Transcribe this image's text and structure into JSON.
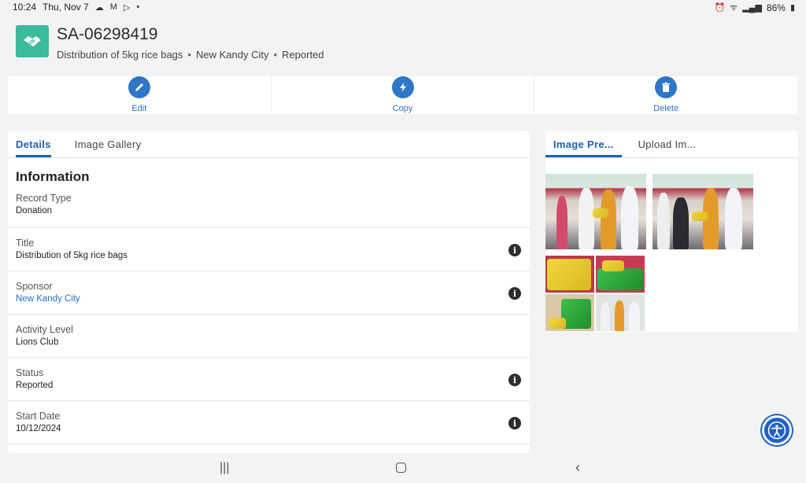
{
  "status_bar": {
    "time": "10:24",
    "date": "Thu, Nov 7",
    "battery": "86%"
  },
  "record": {
    "number": "SA-06298419",
    "subtitle_title": "Distribution of 5kg rice bags",
    "subtitle_sponsor": "New Kandy City",
    "subtitle_status": "Reported",
    "icon": "handshake-icon",
    "icon_color": "#3bba9c"
  },
  "actions": [
    {
      "label": "Edit",
      "icon": "pencil-icon"
    },
    {
      "label": "Copy",
      "icon": "lightning-icon"
    },
    {
      "label": "Delete",
      "icon": "trash-icon"
    }
  ],
  "left_tabs": {
    "details": "Details",
    "gallery": "Image Gallery"
  },
  "section_title": "Information",
  "fields": {
    "record_type": {
      "label": "Record Type",
      "value": "Donation"
    },
    "title": {
      "label": "Title",
      "value": "Distribution of 5kg rice bags"
    },
    "sponsor": {
      "label": "Sponsor",
      "value": "New Kandy City"
    },
    "activity_level": {
      "label": "Activity Level",
      "value": "Lions Club"
    },
    "status": {
      "label": "Status",
      "value": "Reported"
    },
    "start_date": {
      "label": "Start Date",
      "value": "10/12/2024"
    }
  },
  "right_tabs": {
    "preview": "Image Pre...",
    "upload": "Upload Im..."
  },
  "colors": {
    "accent": "#2e76c7",
    "link": "#2e6fbf"
  }
}
